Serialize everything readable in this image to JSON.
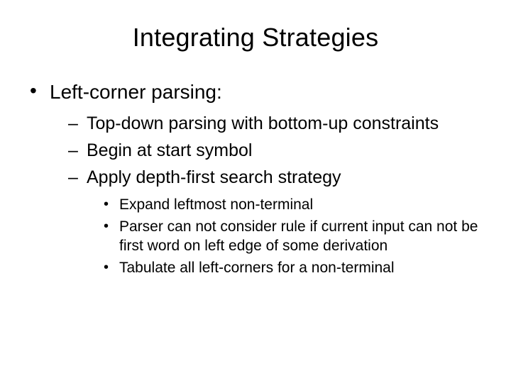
{
  "title": "Integrating Strategies",
  "level1": {
    "item1": "Left-corner parsing:"
  },
  "level2": {
    "item1": "Top-down parsing with bottom-up constraints",
    "item2": "Begin at start symbol",
    "item3": "Apply depth-first search strategy"
  },
  "level3": {
    "item1": "Expand leftmost non-terminal",
    "item2": "Parser can not consider rule if current input can not be first word on left edge of some derivation",
    "item3": "Tabulate all left-corners for a non-terminal"
  }
}
